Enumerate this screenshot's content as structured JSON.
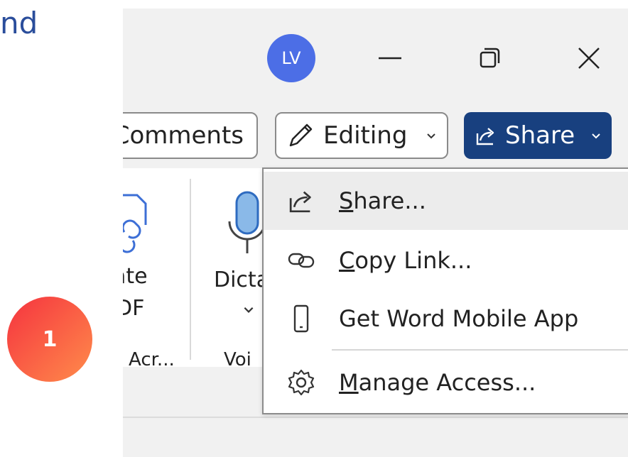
{
  "heading": {
    "text": "nd"
  },
  "step_badge": {
    "number": "1"
  },
  "titlebar": {
    "avatar_initials": "LV"
  },
  "toolbar": {
    "comments_label": "Comments",
    "editing_label": "Editing",
    "share_label": "Share"
  },
  "ribbon": {
    "group1_line1": "ate",
    "group1_line2": "DF",
    "group1_footer": "Acr...",
    "group2_label": "Dicta",
    "group2_footer": "Voi"
  },
  "share_menu": {
    "items": [
      {
        "label": "Share...",
        "accel": "S",
        "rest": "hare...",
        "icon": "share-icon"
      },
      {
        "label": "Copy Link...",
        "accel": "C",
        "rest": "opy Link...",
        "icon": "link-icon"
      },
      {
        "label": "Get Word Mobile App",
        "icon": "mobile-phone-icon"
      },
      {
        "label": "Manage Access...",
        "accel": "M",
        "rest": "anage Access...",
        "icon": "gear-icon"
      }
    ]
  },
  "colors": {
    "heading": "#2a4d9b",
    "avatar": "#4c6ee6",
    "share_button": "#18407f",
    "badge_start": "#f5333f",
    "badge_end": "#ff8c4b"
  }
}
